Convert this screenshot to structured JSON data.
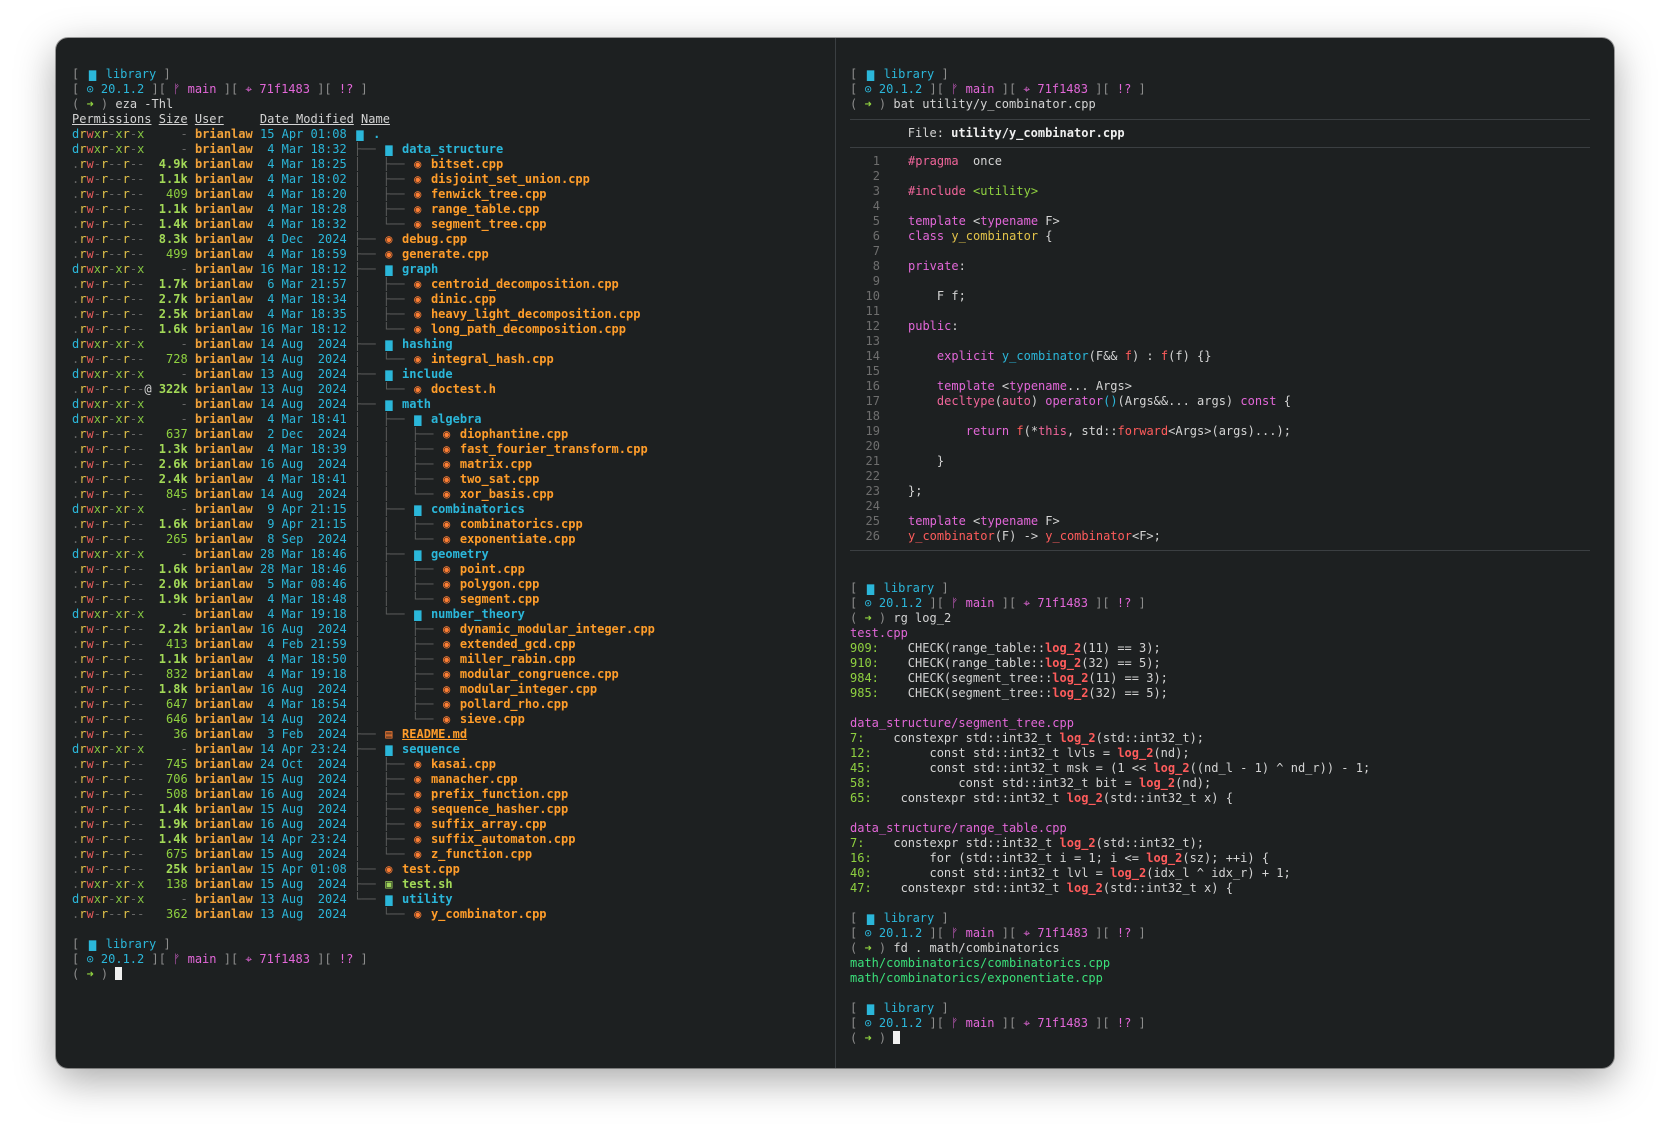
{
  "prompt": {
    "dir": "library",
    "node": "20.1.2",
    "branch": "main",
    "commit": "71f1483",
    "status": "!?",
    "arrow": "➜"
  },
  "left": {
    "command": "eza -Thl",
    "headers": [
      "Permissions",
      "Size",
      "User",
      "Date Modified",
      "Name"
    ],
    "rows": [
      {
        "perm": "drwxr-xr-x",
        "size": "-",
        "user": "brianlaw",
        "date": "15 Apr 01:08",
        "tree": "",
        "icon": "dir",
        "name": "."
      },
      {
        "perm": "drwxr-xr-x",
        "size": "-",
        "user": "brianlaw",
        "date": "4 Mar 18:32",
        "tree": "├── ",
        "icon": "dir",
        "name": "data_structure"
      },
      {
        "perm": ".rw-r--r--",
        "size": "4.9k",
        "user": "brianlaw",
        "date": "4 Mar 18:25",
        "tree": "│   ├── ",
        "icon": "cpp",
        "name": "bitset.cpp"
      },
      {
        "perm": ".rw-r--r--",
        "size": "1.1k",
        "user": "brianlaw",
        "date": "4 Mar 18:02",
        "tree": "│   ├── ",
        "icon": "cpp",
        "name": "disjoint_set_union.cpp"
      },
      {
        "perm": ".rw-r--r--",
        "size": "409",
        "user": "brianlaw",
        "date": "4 Mar 18:20",
        "tree": "│   ├── ",
        "icon": "cpp",
        "name": "fenwick_tree.cpp"
      },
      {
        "perm": ".rw-r--r--",
        "size": "1.1k",
        "user": "brianlaw",
        "date": "4 Mar 18:28",
        "tree": "│   ├── ",
        "icon": "cpp",
        "name": "range_table.cpp"
      },
      {
        "perm": ".rw-r--r--",
        "size": "1.4k",
        "user": "brianlaw",
        "date": "4 Mar 18:32",
        "tree": "│   └── ",
        "icon": "cpp",
        "name": "segment_tree.cpp"
      },
      {
        "perm": ".rw-r--r--",
        "size": "8.3k",
        "user": "brianlaw",
        "date": "4 Dec  2024",
        "tree": "├── ",
        "icon": "cpp",
        "name": "debug.cpp"
      },
      {
        "perm": ".rw-r--r--",
        "size": "499",
        "user": "brianlaw",
        "date": "4 Mar 18:59",
        "tree": "├── ",
        "icon": "cpp",
        "name": "generate.cpp"
      },
      {
        "perm": "drwxr-xr-x",
        "size": "-",
        "user": "brianlaw",
        "date": "16 Mar 18:12",
        "tree": "├── ",
        "icon": "dir",
        "name": "graph"
      },
      {
        "perm": ".rw-r--r--",
        "size": "1.7k",
        "user": "brianlaw",
        "date": "6 Mar 21:57",
        "tree": "│   ├── ",
        "icon": "cpp",
        "name": "centroid_decomposition.cpp"
      },
      {
        "perm": ".rw-r--r--",
        "size": "2.7k",
        "user": "brianlaw",
        "date": "4 Mar 18:34",
        "tree": "│   ├── ",
        "icon": "cpp",
        "name": "dinic.cpp"
      },
      {
        "perm": ".rw-r--r--",
        "size": "2.5k",
        "user": "brianlaw",
        "date": "4 Mar 18:35",
        "tree": "│   ├── ",
        "icon": "cpp",
        "name": "heavy_light_decomposition.cpp"
      },
      {
        "perm": ".rw-r--r--",
        "size": "1.6k",
        "user": "brianlaw",
        "date": "16 Mar 18:12",
        "tree": "│   └── ",
        "icon": "cpp",
        "name": "long_path_decomposition.cpp"
      },
      {
        "perm": "drwxr-xr-x",
        "size": "-",
        "user": "brianlaw",
        "date": "14 Aug  2024",
        "tree": "├── ",
        "icon": "dir",
        "name": "hashing"
      },
      {
        "perm": ".rw-r--r--",
        "size": "728",
        "user": "brianlaw",
        "date": "14 Aug  2024",
        "tree": "│   └── ",
        "icon": "cpp",
        "name": "integral_hash.cpp"
      },
      {
        "perm": "drwxr-xr-x",
        "size": "-",
        "user": "brianlaw",
        "date": "13 Aug  2024",
        "tree": "├── ",
        "icon": "dir",
        "name": "include"
      },
      {
        "perm": ".rw-r--r--@",
        "size": "322k",
        "user": "brianlaw",
        "date": "13 Aug  2024",
        "tree": "│   └── ",
        "icon": "cpp",
        "name": "doctest.h"
      },
      {
        "perm": "drwxr-xr-x",
        "size": "-",
        "user": "brianlaw",
        "date": "14 Aug  2024",
        "tree": "├── ",
        "icon": "dir",
        "name": "math"
      },
      {
        "perm": "drwxr-xr-x",
        "size": "-",
        "user": "brianlaw",
        "date": "4 Mar 18:41",
        "tree": "│   ├── ",
        "icon": "dir",
        "name": "algebra"
      },
      {
        "perm": ".rw-r--r--",
        "size": "637",
        "user": "brianlaw",
        "date": "2 Dec  2024",
        "tree": "│   │   ├── ",
        "icon": "cpp",
        "name": "diophantine.cpp"
      },
      {
        "perm": ".rw-r--r--",
        "size": "1.3k",
        "user": "brianlaw",
        "date": "4 Mar 18:39",
        "tree": "│   │   ├── ",
        "icon": "cpp",
        "name": "fast_fourier_transform.cpp"
      },
      {
        "perm": ".rw-r--r--",
        "size": "2.6k",
        "user": "brianlaw",
        "date": "16 Aug  2024",
        "tree": "│   │   ├── ",
        "icon": "cpp",
        "name": "matrix.cpp"
      },
      {
        "perm": ".rw-r--r--",
        "size": "2.4k",
        "user": "brianlaw",
        "date": "4 Mar 18:41",
        "tree": "│   │   ├── ",
        "icon": "cpp",
        "name": "two_sat.cpp"
      },
      {
        "perm": ".rw-r--r--",
        "size": "845",
        "user": "brianlaw",
        "date": "14 Aug  2024",
        "tree": "│   │   └── ",
        "icon": "cpp",
        "name": "xor_basis.cpp"
      },
      {
        "perm": "drwxr-xr-x",
        "size": "-",
        "user": "brianlaw",
        "date": "9 Apr 21:15",
        "tree": "│   ├── ",
        "icon": "dir",
        "name": "combinatorics"
      },
      {
        "perm": ".rw-r--r--",
        "size": "1.6k",
        "user": "brianlaw",
        "date": "9 Apr 21:15",
        "tree": "│   │   ├── ",
        "icon": "cpp",
        "name": "combinatorics.cpp"
      },
      {
        "perm": ".rw-r--r--",
        "size": "265",
        "user": "brianlaw",
        "date": "8 Sep  2024",
        "tree": "│   │   └── ",
        "icon": "cpp",
        "name": "exponentiate.cpp"
      },
      {
        "perm": "drwxr-xr-x",
        "size": "-",
        "user": "brianlaw",
        "date": "28 Mar 18:46",
        "tree": "│   ├── ",
        "icon": "dir",
        "name": "geometry"
      },
      {
        "perm": ".rw-r--r--",
        "size": "1.6k",
        "user": "brianlaw",
        "date": "28 Mar 18:46",
        "tree": "│   │   ├── ",
        "icon": "cpp",
        "name": "point.cpp"
      },
      {
        "perm": ".rw-r--r--",
        "size": "2.0k",
        "user": "brianlaw",
        "date": "5 Mar 08:46",
        "tree": "│   │   ├── ",
        "icon": "cpp",
        "name": "polygon.cpp"
      },
      {
        "perm": ".rw-r--r--",
        "size": "1.9k",
        "user": "brianlaw",
        "date": "4 Mar 18:48",
        "tree": "│   │   └── ",
        "icon": "cpp",
        "name": "segment.cpp"
      },
      {
        "perm": "drwxr-xr-x",
        "size": "-",
        "user": "brianlaw",
        "date": "4 Mar 19:18",
        "tree": "│   └── ",
        "icon": "dir",
        "name": "number_theory"
      },
      {
        "perm": ".rw-r--r--",
        "size": "2.2k",
        "user": "brianlaw",
        "date": "16 Aug  2024",
        "tree": "│       ├── ",
        "icon": "cpp",
        "name": "dynamic_modular_integer.cpp"
      },
      {
        "perm": ".rw-r--r--",
        "size": "413",
        "user": "brianlaw",
        "date": "4 Feb 21:59",
        "tree": "│       ├── ",
        "icon": "cpp",
        "name": "extended_gcd.cpp"
      },
      {
        "perm": ".rw-r--r--",
        "size": "1.1k",
        "user": "brianlaw",
        "date": "4 Mar 18:50",
        "tree": "│       ├── ",
        "icon": "cpp",
        "name": "miller_rabin.cpp"
      },
      {
        "perm": ".rw-r--r--",
        "size": "832",
        "user": "brianlaw",
        "date": "4 Mar 19:18",
        "tree": "│       ├── ",
        "icon": "cpp",
        "name": "modular_congruence.cpp"
      },
      {
        "perm": ".rw-r--r--",
        "size": "1.8k",
        "user": "brianlaw",
        "date": "16 Aug  2024",
        "tree": "│       ├── ",
        "icon": "cpp",
        "name": "modular_integer.cpp"
      },
      {
        "perm": ".rw-r--r--",
        "size": "647",
        "user": "brianlaw",
        "date": "4 Mar 18:54",
        "tree": "│       ├── ",
        "icon": "cpp",
        "name": "pollard_rho.cpp"
      },
      {
        "perm": ".rw-r--r--",
        "size": "646",
        "user": "brianlaw",
        "date": "14 Aug  2024",
        "tree": "│       └── ",
        "icon": "cpp",
        "name": "sieve.cpp"
      },
      {
        "perm": ".rw-r--r--",
        "size": "36",
        "user": "brianlaw",
        "date": "3 Feb  2024",
        "tree": "├── ",
        "icon": "md",
        "name": "README.md"
      },
      {
        "perm": "drwxr-xr-x",
        "size": "-",
        "user": "brianlaw",
        "date": "14 Apr 23:24",
        "tree": "├── ",
        "icon": "dir",
        "name": "sequence"
      },
      {
        "perm": ".rw-r--r--",
        "size": "745",
        "user": "brianlaw",
        "date": "24 Oct  2024",
        "tree": "│   ├── ",
        "icon": "cpp",
        "name": "kasai.cpp"
      },
      {
        "perm": ".rw-r--r--",
        "size": "706",
        "user": "brianlaw",
        "date": "15 Aug  2024",
        "tree": "│   ├── ",
        "icon": "cpp",
        "name": "manacher.cpp"
      },
      {
        "perm": ".rw-r--r--",
        "size": "508",
        "user": "brianlaw",
        "date": "16 Aug  2024",
        "tree": "│   ├── ",
        "icon": "cpp",
        "name": "prefix_function.cpp"
      },
      {
        "perm": ".rw-r--r--",
        "size": "1.4k",
        "user": "brianlaw",
        "date": "15 Aug  2024",
        "tree": "│   ├── ",
        "icon": "cpp",
        "name": "sequence_hasher.cpp"
      },
      {
        "perm": ".rw-r--r--",
        "size": "1.9k",
        "user": "brianlaw",
        "date": "16 Aug  2024",
        "tree": "│   ├── ",
        "icon": "cpp",
        "name": "suffix_array.cpp"
      },
      {
        "perm": ".rw-r--r--",
        "size": "1.4k",
        "user": "brianlaw",
        "date": "14 Apr 23:24",
        "tree": "│   ├── ",
        "icon": "cpp",
        "name": "suffix_automaton.cpp"
      },
      {
        "perm": ".rw-r--r--",
        "size": "675",
        "user": "brianlaw",
        "date": "15 Aug  2024",
        "tree": "│   └── ",
        "icon": "cpp",
        "name": "z_function.cpp"
      },
      {
        "perm": ".rw-r--r--",
        "size": "25k",
        "user": "brianlaw",
        "date": "15 Apr 01:08",
        "tree": "├── ",
        "icon": "cpp",
        "name": "test.cpp"
      },
      {
        "perm": ".rwxr-xr-x",
        "size": "138",
        "user": "brianlaw",
        "date": "15 Aug  2024",
        "tree": "├── ",
        "icon": "sh",
        "name": "test.sh"
      },
      {
        "perm": "drwxr-xr-x",
        "size": "-",
        "user": "brianlaw",
        "date": "13 Aug  2024",
        "tree": "└── ",
        "icon": "dir",
        "name": "utility"
      },
      {
        "perm": ".rw-r--r--",
        "size": "362",
        "user": "brianlaw",
        "date": "13 Aug  2024",
        "tree": "    └── ",
        "icon": "cpp",
        "name": "y_combinator.cpp"
      }
    ]
  },
  "right": {
    "bat_command": "bat utility/y_combinator.cpp",
    "bat_file_label": "File: ",
    "bat_file_name": "utility/y_combinator.cpp",
    "bat_lines": [
      [
        [
          "k-pink",
          "#pragma"
        ],
        [
          "",
          "  once"
        ]
      ],
      [],
      [
        [
          "k-pink",
          "#include"
        ],
        [
          "k-str",
          " <utility>"
        ]
      ],
      [],
      [
        [
          "k-kw",
          "template"
        ],
        [
          "",
          " <"
        ],
        [
          "k-kw",
          "typename"
        ],
        [
          "",
          " F>"
        ]
      ],
      [
        [
          "k-kw",
          "class"
        ],
        [
          "k-type",
          " y_combinator"
        ],
        [
          "",
          " {"
        ]
      ],
      [],
      [
        [
          "k-kw",
          "private"
        ],
        [
          "",
          ":"
        ]
      ],
      [],
      [
        [
          "",
          "    F f;"
        ]
      ],
      [],
      [
        [
          "k-kw",
          "public"
        ],
        [
          "",
          ":"
        ]
      ],
      [],
      [
        [
          "",
          "    "
        ],
        [
          "k-kw",
          "explicit"
        ],
        [
          "k-fn",
          " y_combinator"
        ],
        [
          "",
          "(F&& "
        ],
        [
          "k-red",
          "f"
        ],
        [
          "",
          ") : "
        ],
        [
          "k-red",
          "f"
        ],
        [
          "",
          "(f) {}"
        ]
      ],
      [],
      [
        [
          "",
          "    "
        ],
        [
          "k-kw",
          "template"
        ],
        [
          "",
          " <"
        ],
        [
          "k-kw",
          "typename"
        ],
        [
          "",
          "... Args>"
        ]
      ],
      [
        [
          "",
          "    "
        ],
        [
          "k-pink",
          "decltype"
        ],
        [
          "",
          "("
        ],
        [
          "k-pink",
          "auto"
        ],
        [
          "",
          ") "
        ],
        [
          "k-kw",
          "operator"
        ],
        [
          "k-fn",
          "()"
        ],
        [
          "",
          "(Args&&... args) "
        ],
        [
          "k-kw",
          "const"
        ],
        [
          "",
          " {"
        ]
      ],
      [],
      [
        [
          "",
          "        "
        ],
        [
          "k-kw",
          "return"
        ],
        [
          "k-red",
          " f"
        ],
        [
          "",
          "(*"
        ],
        [
          "k-pink",
          "this"
        ],
        [
          "",
          ", std::"
        ],
        [
          "k-red",
          "forward"
        ],
        [
          "",
          "<Args>(args)...);"
        ]
      ],
      [],
      [
        [
          "",
          "    }"
        ]
      ],
      [],
      [
        [
          "",
          "};"
        ]
      ],
      [],
      [
        [
          "k-kw",
          "template"
        ],
        [
          "",
          " <"
        ],
        [
          "k-kw",
          "typename"
        ],
        [
          "",
          " F>"
        ]
      ],
      [
        [
          "k-red",
          "y_combinator"
        ],
        [
          "",
          "(F) -> "
        ],
        [
          "k-red",
          "y_combinator"
        ],
        [
          "",
          "<F>;"
        ]
      ]
    ],
    "rg_command": "rg log_2",
    "rg_groups": [
      {
        "file": "test.cpp",
        "lines": [
          {
            "num": "909:",
            "pre": "    CHECK(range_table::",
            "hl": "log_2",
            "post": "(11) == 3);"
          },
          {
            "num": "910:",
            "pre": "    CHECK(range_table::",
            "hl": "log_2",
            "post": "(32) == 5);"
          },
          {
            "num": "984:",
            "pre": "    CHECK(segment_tree::",
            "hl": "log_2",
            "post": "(11) == 3);"
          },
          {
            "num": "985:",
            "pre": "    CHECK(segment_tree::",
            "hl": "log_2",
            "post": "(32) == 5);"
          }
        ]
      },
      {
        "file": "data_structure/segment_tree.cpp",
        "lines": [
          {
            "num": "7:",
            "pre": "    constexpr std::int32_t ",
            "hl": "log_2",
            "post": "(std::int32_t);"
          },
          {
            "num": "12:",
            "pre": "        const std::int32_t lvls = ",
            "hl": "log_2",
            "post": "(nd);"
          },
          {
            "num": "45:",
            "pre": "        const std::int32_t msk = (1 << ",
            "hl": "log_2",
            "post": "((nd_l - 1) ^ nd_r)) - 1;"
          },
          {
            "num": "58:",
            "pre": "            const std::int32_t bit = ",
            "hl": "log_2",
            "post": "(nd);"
          },
          {
            "num": "65:",
            "pre": "    constexpr std::int32_t ",
            "hl": "log_2",
            "post": "(std::int32_t x) {"
          }
        ]
      },
      {
        "file": "data_structure/range_table.cpp",
        "lines": [
          {
            "num": "7:",
            "pre": "    constexpr std::int32_t ",
            "hl": "log_2",
            "post": "(std::int32_t);"
          },
          {
            "num": "16:",
            "pre": "        for (std::int32_t i = 1; i <= ",
            "hl": "log_2",
            "post": "(sz); ++i) {"
          },
          {
            "num": "40:",
            "pre": "        const std::int32_t lvl = ",
            "hl": "log_2",
            "post": "(idx_l ^ idx_r) + 1;"
          },
          {
            "num": "47:",
            "pre": "    constexpr std::int32_t ",
            "hl": "log_2",
            "post": "(std::int32_t x) {"
          }
        ]
      }
    ],
    "fd_command": "fd . math/combinatorics",
    "fd_results": [
      "math/combinatorics/combinatorics.cpp",
      "math/combinatorics/exponentiate.cpp"
    ]
  },
  "colors": {
    "background": "#1d2021",
    "accent_cyan": "#2bb7da",
    "accent_magenta": "#e267d8",
    "file_orange": "#ff9d2a"
  }
}
